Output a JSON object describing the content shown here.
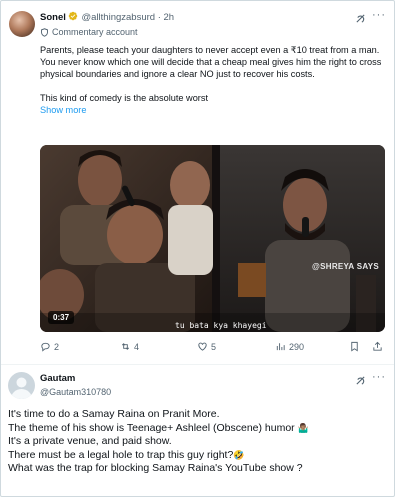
{
  "tweet": {
    "author_name": "Sonel",
    "author_handle": "@allthingzabsurd",
    "separator": "·",
    "time": "2h",
    "account_label": "Commentary account",
    "more_label": "···",
    "paragraph1": "Parents, please teach your daughters to never accept even a ₹10 treat from a man. You never know which one will decide that a cheap meal gives him the right to cross physical boundaries and ignore a clear NO just to recover his costs.",
    "paragraph2": "This kind of comedy is the absolute worst",
    "show_more": "Show more",
    "video": {
      "duration": "0:37",
      "subtitle": "tu bata kya khayegi",
      "watermark": "@SHREYA SAYS"
    },
    "actions": {
      "replies": "2",
      "reposts": "4",
      "likes": "5",
      "views": "290"
    }
  },
  "reply": {
    "author_name": "Gautam",
    "author_handle": "@Gautam310780",
    "more_label": "···",
    "lines": [
      "It's time to do a Samay Raina on Pranit More.",
      "The theme of his show is Teenage+ Ashleel  (Obscene) humor",
      "It's a private venue, and paid show.",
      "There must be a legal hole to trap this guy right?",
      "What was the trap for blocking Samay Raina's YouTube show ?"
    ],
    "emoji_1": "🤷🏽‍♂️",
    "emoji_2": "🤣"
  },
  "colors": {
    "accent": "#1d9bf0",
    "verified_gold": "#e2b719",
    "secondary_text": "#536471",
    "border": "#cfd9de"
  }
}
